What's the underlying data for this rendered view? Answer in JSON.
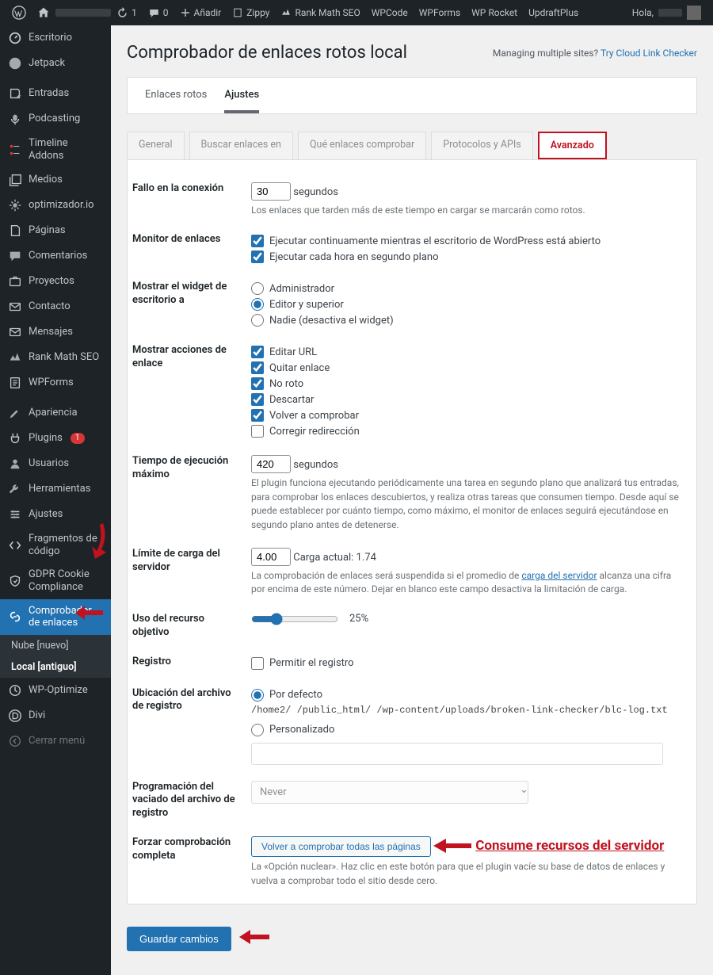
{
  "toolbar": {
    "updates_count": "1",
    "comments_count": "0",
    "add": "Añadir",
    "items": [
      "Zippy",
      "Rank Math SEO",
      "WPCode",
      "WPForms",
      "WP Rocket",
      "UpdraftPlus"
    ],
    "greeting": "Hola,"
  },
  "sidebar": {
    "items": [
      {
        "label": "Escritorio"
      },
      {
        "label": "Jetpack"
      },
      {
        "label": "Entradas"
      },
      {
        "label": "Podcasting"
      },
      {
        "label": "Timeline Addons"
      },
      {
        "label": "Medios"
      },
      {
        "label": "optimizador.io"
      },
      {
        "label": "Páginas"
      },
      {
        "label": "Comentarios"
      },
      {
        "label": "Proyectos"
      },
      {
        "label": "Contacto"
      },
      {
        "label": "Mensajes"
      },
      {
        "label": "Rank Math SEO"
      },
      {
        "label": "WPForms"
      },
      {
        "label": "Apariencia"
      },
      {
        "label": "Plugins",
        "badge": "1"
      },
      {
        "label": "Usuarios"
      },
      {
        "label": "Herramientas"
      },
      {
        "label": "Ajustes"
      },
      {
        "label": "Fragmentos de código"
      },
      {
        "label": "GDPR Cookie Compliance"
      },
      {
        "label": "Comprobador de enlaces",
        "current": true
      },
      {
        "label": "WP-Optimize"
      },
      {
        "label": "Divi"
      },
      {
        "label": "Cerrar menú"
      }
    ],
    "submenu": {
      "items": [
        {
          "label": "Nube [nuevo]"
        },
        {
          "label": "Local [antiguo]",
          "active": true
        }
      ]
    }
  },
  "header": {
    "title": "Comprobador de enlaces rotos local",
    "managing_text": "Managing multiple sites?",
    "managing_link": "Try Cloud Link Checker"
  },
  "top_tabs": [
    {
      "label": "Enlaces rotos"
    },
    {
      "label": "Ajustes",
      "active": true
    }
  ],
  "subtabs": [
    {
      "label": "General"
    },
    {
      "label": "Buscar enlaces en"
    },
    {
      "label": "Qué enlaces comprobar"
    },
    {
      "label": "Protocolos y APIs"
    },
    {
      "label": "Avanzado",
      "active": true
    }
  ],
  "form": {
    "timeout_label": "Fallo en la conexión",
    "timeout_value": "30",
    "timeout_unit": "segundos",
    "timeout_desc": "Los enlaces que tarden más de este tiempo en cargar se marcarán como rotos.",
    "monitor_label": "Monitor de enlaces",
    "monitor_opts": [
      "Ejecutar continuamente mientras el escritorio de WordPress está abierto",
      "Ejecutar cada hora en segundo plano"
    ],
    "widget_label": "Mostrar el widget de escritorio a",
    "widget_opts": [
      "Administrador",
      "Editor y superior",
      "Nadie (desactiva el widget)"
    ],
    "actions_label": "Mostrar acciones de enlace",
    "actions_opts": [
      "Editar URL",
      "Quitar enlace",
      "No roto",
      "Descartar",
      "Volver a comprobar",
      "Corregir redirección"
    ],
    "maxtime_label": "Tiempo de ejecución máximo",
    "maxtime_value": "420",
    "maxtime_unit": "segundos",
    "maxtime_desc": "El plugin funciona ejecutando periódicamente una tarea en segundo plano que analizará tus entradas, para comprobar los enlaces descubiertos, y realiza otras tareas que consumen tiempo. Desde aquí se puede establecer por cuánto tiempo, como máximo, el monitor de enlaces seguirá ejecutándose en segundo plano antes de detenerse.",
    "load_label": "Límite de carga del servidor",
    "load_value": "4.00",
    "load_current": "Carga actual: 1.74",
    "load_desc_a": "La comprobación de enlaces será suspendida si el promedio de ",
    "load_desc_link": "carga del servidor",
    "load_desc_b": " alcanza una cifra por encima de este número. Dejar en blanco este campo desactiva la limitación de carga.",
    "resource_label": "Uso del recurso objetivo",
    "resource_pct": "25%",
    "log_label": "Registro",
    "log_opt": "Permitir el registro",
    "logfile_label": "Ubicación del archivo de registro",
    "logfile_default": "Por defecto",
    "logfile_path": "/home2/        /public_html/     /wp-content/uploads/broken-link-checker/blc-log.txt",
    "logfile_custom": "Personalizado",
    "schedule_label": "Programación del vaciado del archivo de registro",
    "schedule_value": "Never",
    "force_label": "Forzar comprobación completa",
    "force_btn": "Volver a comprobar todas las páginas",
    "force_desc": "La «Opción nuclear». Haz clic en este botón para que el plugin vacíe su base de datos de enlaces y vuelva a comprobar todo el sitio desde cero.",
    "force_annot": "Consume recursos del servidor",
    "save_btn": "Guardar cambios"
  }
}
